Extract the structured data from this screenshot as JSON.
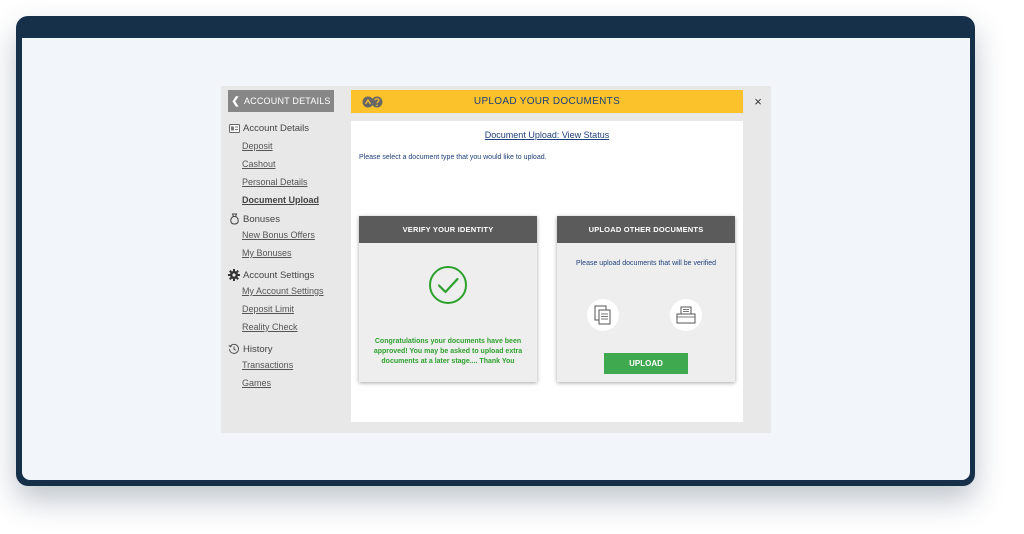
{
  "sidebar": {
    "back_label": "ACCOUNT DETAILS",
    "sections": [
      {
        "title": "Account Details",
        "icon": "id-card-icon",
        "items": [
          "Deposit",
          "Cashout",
          "Personal Details",
          "Document Upload"
        ]
      },
      {
        "title": "Bonuses",
        "icon": "money-bag-icon",
        "items": [
          "New Bonus Offers",
          "My Bonuses"
        ]
      },
      {
        "title": "Account Settings",
        "icon": "gear-icon",
        "items": [
          "My Account Settings",
          "Deposit Limit",
          "Reality Check"
        ]
      },
      {
        "title": "History",
        "icon": "history-icon",
        "items": [
          "Transactions",
          "Games"
        ]
      }
    ],
    "active_item": "Document Upload"
  },
  "header": {
    "title": "UPLOAD YOUR DOCUMENTS",
    "close_glyph": "×",
    "accent_color": "#fcc22b"
  },
  "content": {
    "status_link": "Document Upload: View Status",
    "instruction": "Please select a document type that you would like to upload.",
    "verify_card": {
      "title": "VERIFY YOUR IDENTITY",
      "message": "Congratulations your documents have been approved! You may be asked to upload extra documents at a later stage.... Thank You",
      "icon": "check-circle-icon",
      "message_color": "#2ea12e"
    },
    "other_card": {
      "title": "UPLOAD OTHER DOCUMENTS",
      "subtitle": "Please upload documents that will be verified",
      "icons": [
        "documents-icon",
        "scanner-icon"
      ],
      "button_label": "UPLOAD",
      "button_color": "#3fa94f"
    }
  }
}
